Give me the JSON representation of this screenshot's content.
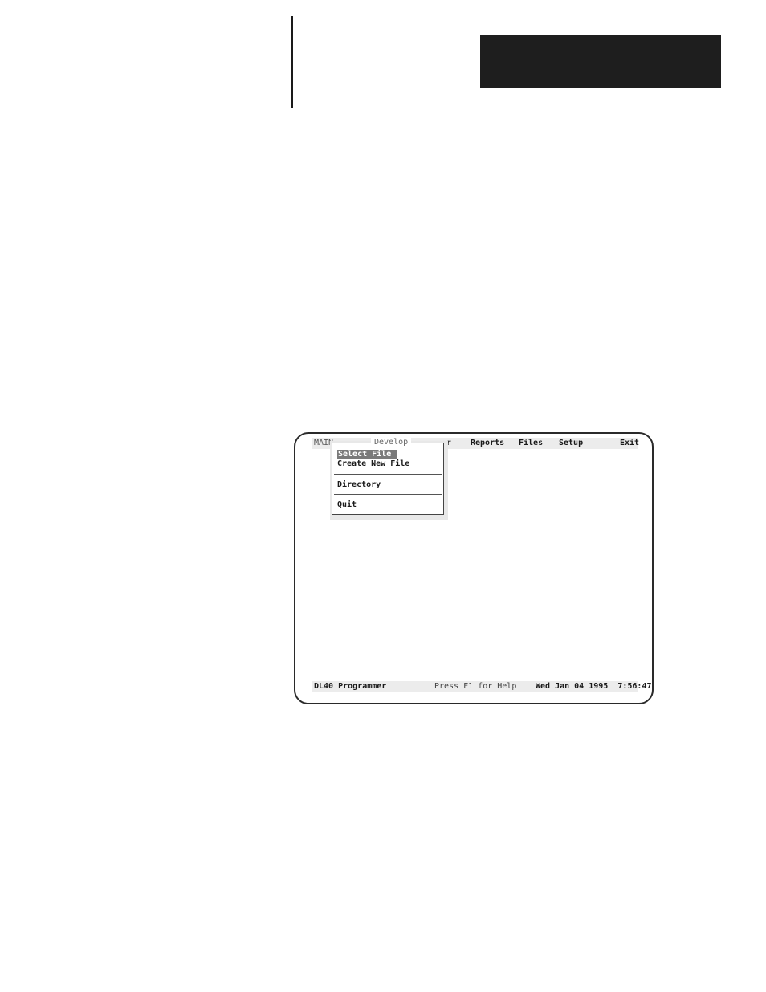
{
  "screen": {
    "menubar": {
      "main": "MAIN",
      "partial": "r",
      "reports": "Reports",
      "files": "Files",
      "setup": "Setup",
      "exit": "Exit"
    },
    "dropdown": {
      "title": "Develop",
      "items": [
        "Select File",
        "Create New File",
        "Directory",
        "Quit"
      ],
      "selected": "Select File"
    },
    "statusbar": {
      "app": "DL40 Programmer",
      "help": "Press F1 for Help",
      "datetime": "Wed Jan 04 1995  7:56:47"
    }
  }
}
